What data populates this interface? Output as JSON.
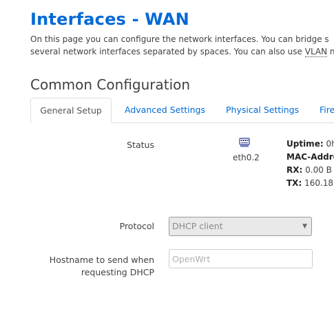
{
  "header": {
    "title": "Interfaces - WAN",
    "description_line1": "On this page you can configure the network interfaces. You can bridge s",
    "description_line2_pre": "several network interfaces separated by spaces. You can also use ",
    "description_line2_link": "VLAN",
    "description_line2_post": " n"
  },
  "section": {
    "title": "Common Configuration",
    "tabs": [
      {
        "label": "General Setup",
        "active": true
      },
      {
        "label": "Advanced Settings",
        "active": false
      },
      {
        "label": "Physical Settings",
        "active": false
      },
      {
        "label": "Fire",
        "active": false
      }
    ]
  },
  "status": {
    "label": "Status",
    "device": "eth0.2",
    "icon": "ethernet-port-icon",
    "uptime_label": "Uptime:",
    "uptime_value": "0h",
    "mac_label": "MAC-Addre",
    "rx_label": "RX:",
    "rx_value": "0.00 B (",
    "tx_label": "TX:",
    "tx_value": "160.18 I"
  },
  "protocol": {
    "label": "Protocol",
    "value": "DHCP client"
  },
  "hostname": {
    "label_line1": "Hostname to send when",
    "label_line2": "requesting DHCP",
    "placeholder": "OpenWrt"
  },
  "colors": {
    "accent": "#0069d6",
    "text": "#404040",
    "border": "#dddddd"
  }
}
